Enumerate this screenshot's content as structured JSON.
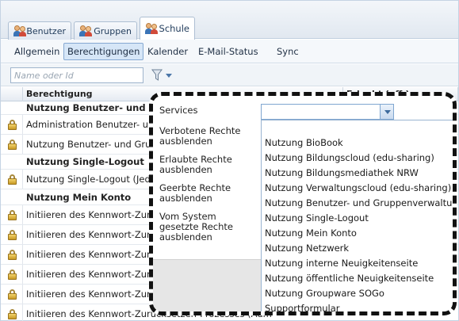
{
  "top_tabs": [
    {
      "label": "Benutzer",
      "icon": "users-icon"
    },
    {
      "label": "Gruppen",
      "icon": "users-icon"
    },
    {
      "label": "Schule",
      "icon": "users-icon",
      "active": true
    }
  ],
  "sub_tabs": [
    {
      "label": "Allgemein"
    },
    {
      "label": "Berechtigungen",
      "active": true
    },
    {
      "label": "Kalender"
    },
    {
      "label": "E-Mail-Status"
    },
    {
      "label": "Sync"
    }
  ],
  "filter": {
    "placeholder": "Name oder Id",
    "value": ""
  },
  "grid": {
    "columns": [
      "Berechtigung",
      "Erlaubt (eff.)"
    ],
    "rows": [
      {
        "type": "group",
        "text": "Nutzung Benutzer- und Gruppenverwaltung"
      },
      {
        "type": "item",
        "text": "Administration Benutzer- und Gruppenverwaltung",
        "locked": true
      },
      {
        "type": "item",
        "text": "Nutzung Benutzer- und Gruppenverwaltung",
        "locked": true
      },
      {
        "type": "group",
        "text": "Nutzung Single-Logout"
      },
      {
        "type": "item",
        "text": "Nutzung Single-Logout (Jederzeit)",
        "locked": true
      },
      {
        "type": "group",
        "text": "Nutzung Mein Konto"
      },
      {
        "type": "item",
        "text": "Initiieren des Kennwort-Zurücksetzen-Prozesses",
        "locked": true
      },
      {
        "type": "item",
        "text": "Initiieren des Kennwort-Zurücksetzen-Prozesses",
        "locked": true
      },
      {
        "type": "item",
        "text": "Initiieren des Kennwort-Zurücksetzen-Prozesses",
        "locked": true
      },
      {
        "type": "item",
        "text": "Initiieren des Kennwort-Zurücksetzen-Prozesses",
        "locked": true
      },
      {
        "type": "item",
        "text": "Initiieren des Kennwort-Zurücksetzen-Prozesses (Adm",
        "locked": true
      },
      {
        "type": "item",
        "text": "Initiieren des Kennwort-Zurücksetzen-Prozesses (Adm",
        "locked": true
      }
    ]
  },
  "dialog": {
    "labels": [
      "Services",
      "Verbotene Rechte ausblenden",
      "Erlaubte Rechte ausblenden",
      "Geerbte Rechte ausblenden",
      "Vom System gesetzte Rechte ausblenden"
    ],
    "services_value": "",
    "options": [
      "",
      "Nutzung BioBook",
      "Nutzung Bildungscloud (edu-sharing)",
      "Nutzung Bildungsmediathek NRW",
      "Nutzung Verwaltungscloud (edu-sharing)",
      "Nutzung Benutzer- und Gruppenverwaltung",
      "Nutzung Single-Logout",
      "Nutzung Mein Konto",
      "Nutzung Netzwerk",
      "Nutzung interne Neuigkeitenseite",
      "Nutzung öffentliche Neuigkeitenseite",
      "Nutzung Groupware SOGo",
      "Supportformular"
    ]
  }
}
